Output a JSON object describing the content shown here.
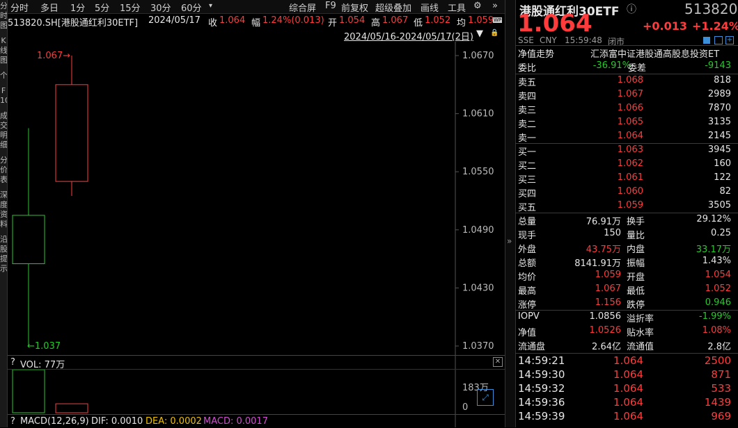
{
  "left_strip": [
    "分",
    "时",
    "图",
    "",
    "K",
    "线",
    "图",
    "",
    "个",
    "",
    "F",
    "10",
    "",
    "成",
    "交",
    "明",
    "细",
    "",
    "分",
    "价",
    "表",
    "",
    "深",
    "度",
    "资",
    "料",
    "",
    "沿",
    "股",
    "提",
    "示"
  ],
  "toolbar": {
    "items": [
      "分时",
      "多日",
      "1分",
      "5分",
      "15分",
      "30分",
      "60分",
      "▾",
      "综合屏",
      "F9",
      "前复权",
      "超级叠加",
      "画线",
      "工具"
    ],
    "gear_icon": "⚙",
    "more_icon": "»"
  },
  "info": {
    "code_name": "513820.SH[港股通红利30ETF]",
    "date": "2024/05/17",
    "close_label": "收",
    "close_value": "1.064",
    "amp_label": "幅",
    "amp_value": "1.24%(0.013)",
    "open_label": "开",
    "open_value": "1.054",
    "high_label": "高",
    "high_value": "1.067",
    "low_label": "低",
    "low_value": "1.052",
    "avg_label": "均",
    "avg_value": "1.059",
    "wp_badge": "WP"
  },
  "range_text": "2024/05/16-2024/05/17(2日)",
  "range_arrow": "▼",
  "lock_icon": "🔒",
  "chart_data": {
    "type": "candlestick",
    "candles": [
      {
        "open": 1.0505,
        "close": 1.0455,
        "high": 1.0595,
        "low": 1.037
      },
      {
        "open": 1.054,
        "close": 1.064,
        "high": 1.067,
        "low": 1.0525
      }
    ],
    "y_ticks": [
      "1.0670",
      "1.0610",
      "1.0550",
      "1.0490",
      "1.0430",
      "1.0370"
    ],
    "ylim": [
      1.037,
      1.067
    ],
    "high_marker": "1.067",
    "low_marker": "1.037",
    "volume_max_label": "183万",
    "volume_zero_label": "0",
    "volume_values": [
      183,
      38
    ]
  },
  "volume": {
    "q": "?",
    "label": "VOL: 77万"
  },
  "macd": {
    "q": "?",
    "label": "MACD(12,26,9)",
    "dif": "DIF: 0.0010",
    "dea": "DEA: 0.0002",
    "macd": "MACD: 0.0017"
  },
  "quote": {
    "name": "港股通红利30ETF",
    "info_icon": "ⓘ",
    "code": "513820",
    "price": "1.064",
    "change": "+0.013",
    "change_pct": "+1.24%",
    "market": "SSE",
    "currency": "CNY",
    "time": "15:59:48",
    "status": "闭市",
    "nav_trend_label": "净值走势",
    "fund_company": "汇添富中证港股通高股息投资ET",
    "wb_label": "委比",
    "wb_value": "-36.91%",
    "wc_label": "委差",
    "wc_value": "-9143",
    "asks": [
      {
        "label": "卖五",
        "price": "1.068",
        "vol": "818"
      },
      {
        "label": "卖四",
        "price": "1.067",
        "vol": "2989"
      },
      {
        "label": "卖三",
        "price": "1.066",
        "vol": "7870"
      },
      {
        "label": "卖二",
        "price": "1.065",
        "vol": "3135"
      },
      {
        "label": "卖一",
        "price": "1.064",
        "vol": "2145"
      }
    ],
    "bids": [
      {
        "label": "买一",
        "price": "1.063",
        "vol": "3945"
      },
      {
        "label": "买二",
        "price": "1.062",
        "vol": "160"
      },
      {
        "label": "买三",
        "price": "1.061",
        "vol": "122"
      },
      {
        "label": "买四",
        "price": "1.060",
        "vol": "82"
      },
      {
        "label": "买五",
        "price": "1.059",
        "vol": "3505"
      }
    ],
    "stats": [
      {
        "l1": "总量",
        "v1": "76.91万",
        "c1": "white",
        "l2": "换手",
        "v2": "29.12%",
        "c2": "white"
      },
      {
        "l1": "现手",
        "v1": "150",
        "c1": "white",
        "l2": "量比",
        "v2": "0.25",
        "c2": "white"
      },
      {
        "l1": "外盘",
        "v1": "43.75万",
        "c1": "red",
        "l2": "内盘",
        "v2": "33.17万",
        "c2": "green"
      },
      {
        "l1": "总额",
        "v1": "8141.91万",
        "c1": "white",
        "l2": "振幅",
        "v2": "1.43%",
        "c2": "white"
      },
      {
        "l1": "均价",
        "v1": "1.059",
        "c1": "red",
        "l2": "开盘",
        "v2": "1.054",
        "c2": "red"
      },
      {
        "l1": "最高",
        "v1": "1.067",
        "c1": "red",
        "l2": "最低",
        "v2": "1.052",
        "c2": "red"
      },
      {
        "l1": "涨停",
        "v1": "1.156",
        "c1": "red",
        "l2": "跌停",
        "v2": "0.946",
        "c2": "green"
      }
    ],
    "stats2": [
      {
        "l1": "IOPV",
        "v1": "1.0856",
        "c1": "white",
        "l2": "溢折率",
        "v2": "-1.99%",
        "c2": "green"
      },
      {
        "l1": "净值",
        "v1": "1.0526",
        "c1": "red",
        "l2": "贴水率",
        "v2": "1.08%",
        "c2": "red"
      },
      {
        "l1": "流通盘",
        "v1": "2.64亿",
        "c1": "white",
        "l2": "流通值",
        "v2": "2.8亿",
        "c2": "white"
      }
    ],
    "ticks": [
      {
        "time": "14:59:21",
        "price": "1.064",
        "vol": "2500"
      },
      {
        "time": "14:59:30",
        "price": "1.064",
        "vol": "871"
      },
      {
        "time": "14:59:32",
        "price": "1.064",
        "vol": "533"
      },
      {
        "time": "14:59:36",
        "price": "1.064",
        "vol": "1439"
      },
      {
        "time": "14:59:39",
        "price": "1.064",
        "vol": "969"
      }
    ]
  },
  "colors": {
    "up": "#ff3b3b",
    "down": "#27c92c",
    "axis": "#555555"
  }
}
